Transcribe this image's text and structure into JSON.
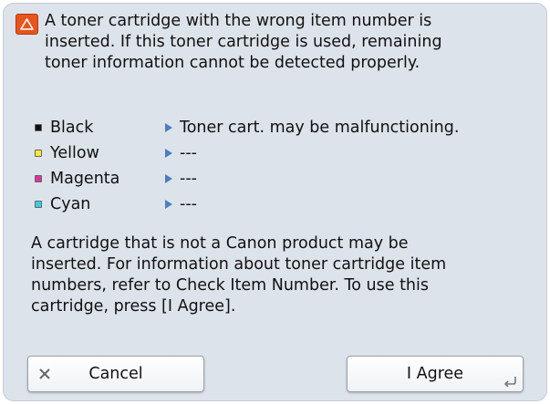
{
  "header": {
    "icon": "warning-icon",
    "message_lines": [
      "A toner cartridge with the wrong item number is",
      "inserted. If this toner cartridge is used, remaining",
      "toner information cannot be detected properly."
    ]
  },
  "toners": [
    {
      "name": "Black",
      "color": "#111111",
      "status": "Toner cart. may be malfunctioning."
    },
    {
      "name": "Yellow",
      "color": "#f4ea3a",
      "status": "---"
    },
    {
      "name": "Magenta",
      "color": "#e0329a",
      "status": "---"
    },
    {
      "name": "Cyan",
      "color": "#38d0e0",
      "status": "---"
    }
  ],
  "info": {
    "message_lines": [
      "A cartridge that is not a Canon product may be",
      "inserted. For information about toner cartridge item",
      "numbers, refer to Check Item Number. To use this",
      "cartridge, press [I Agree]."
    ]
  },
  "buttons": {
    "cancel": {
      "label": "Cancel",
      "icon": "close-icon"
    },
    "agree": {
      "label": "I Agree",
      "icon": "enter-icon"
    }
  },
  "colors": {
    "panel_background": "#dde3ea",
    "warning": "#e8541e",
    "arrow": "#4a7fc0"
  }
}
